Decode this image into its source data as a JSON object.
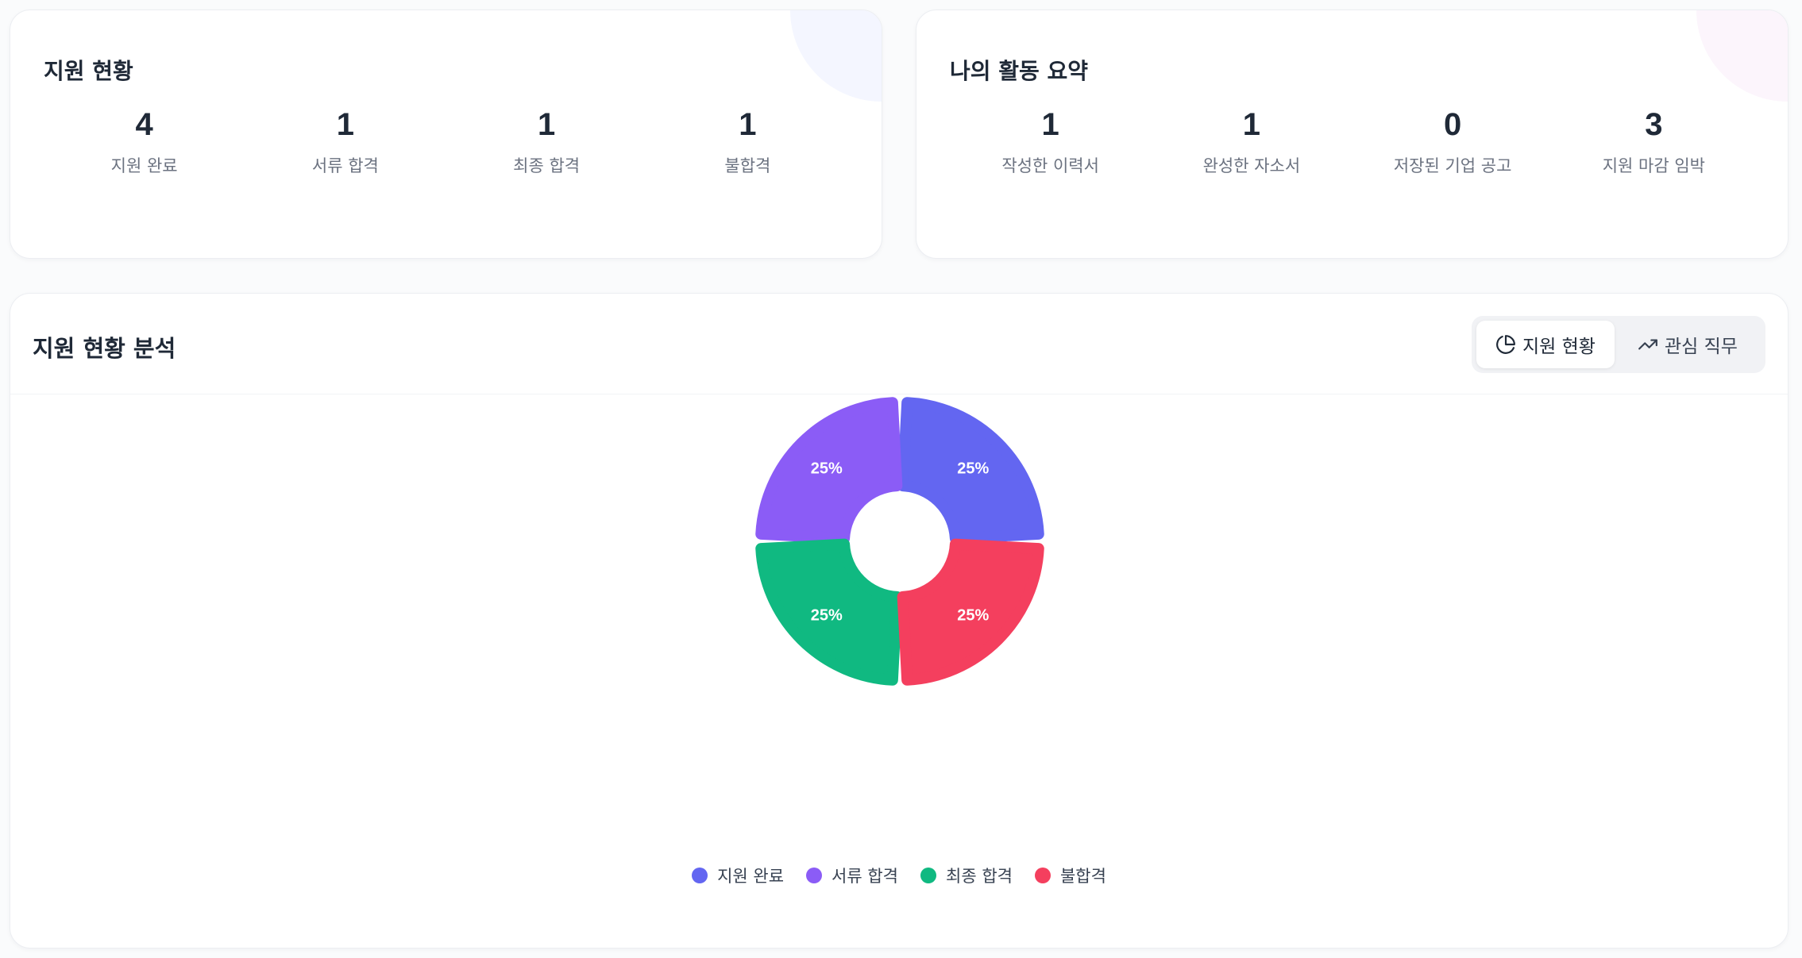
{
  "apply_status": {
    "title": "지원 현황",
    "stats": [
      {
        "value": "4",
        "label": "지원 완료"
      },
      {
        "value": "1",
        "label": "서류 합격"
      },
      {
        "value": "1",
        "label": "최종 합격"
      },
      {
        "value": "1",
        "label": "불합격"
      }
    ]
  },
  "activity_summary": {
    "title": "나의 활동 요약",
    "stats": [
      {
        "value": "1",
        "label": "작성한 이력서"
      },
      {
        "value": "1",
        "label": "완성한 자소서"
      },
      {
        "value": "0",
        "label": "저장된 기업 공고"
      },
      {
        "value": "3",
        "label": "지원 마감 임박"
      }
    ]
  },
  "analysis": {
    "title": "지원 현황 분석",
    "tabs": [
      {
        "label": "지원 현황",
        "icon": "pie-chart-icon",
        "active": true
      },
      {
        "label": "관심 직무",
        "icon": "trending-up-icon",
        "active": false
      }
    ]
  },
  "colors": {
    "indigo": "#6366f1",
    "purple": "#8b5cf6",
    "green": "#10b981",
    "red": "#f43f5e"
  },
  "chart_data": {
    "type": "pie",
    "variant": "donut",
    "categories": [
      "지원 완료",
      "서류 합격",
      "최종 합격",
      "불합격"
    ],
    "values": [
      25,
      25,
      25,
      25
    ],
    "labels": [
      "25%",
      "25%",
      "25%",
      "25%"
    ],
    "colors": [
      "#6366f1",
      "#8b5cf6",
      "#10b981",
      "#f43f5e"
    ],
    "legend": "bottom"
  }
}
